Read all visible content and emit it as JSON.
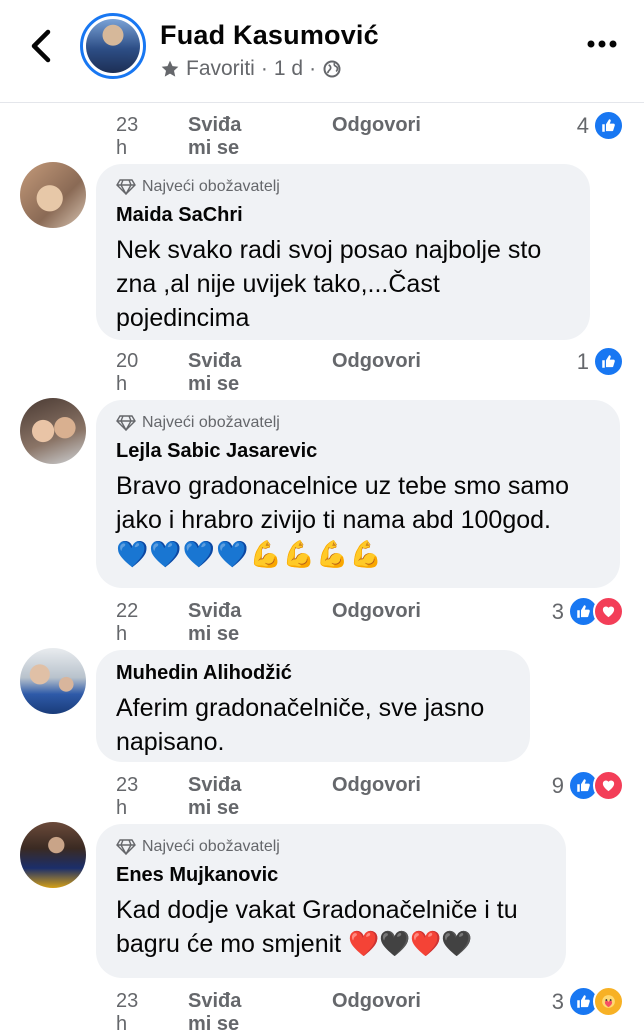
{
  "header": {
    "name": "Fuad Kasumović",
    "favorites": "Favoriti",
    "sep1": "·",
    "time": "1 d",
    "sep2": "·"
  },
  "top_actions": {
    "time": "23 h",
    "like": "Sviđa mi se",
    "reply": "Odgovori",
    "count": "4"
  },
  "comments": [
    {
      "badge": "Najveći obožavatelj",
      "author": "Maida SaChri",
      "text": [
        "Nek svako radi svoj posao najbolje sto",
        "zna ,al nije uvijek tako,...Čast",
        "pojedincima"
      ],
      "time": "20 h",
      "like": "Sviđa mi se",
      "reply": "Odgovori",
      "count": "1"
    },
    {
      "badge": "Najveći obožavatelj",
      "author": "Lejla Sabic Jasarevic",
      "text": [
        "Bravo gradonacelnice uz tebe smo samo",
        "jako i hrabro zivijo ti nama abd 100god.",
        "💙💙💙💙💪💪💪💪"
      ],
      "time": "22 h",
      "like": "Sviđa mi se",
      "reply": "Odgovori",
      "count": "3"
    },
    {
      "author": "Muhedin Alihodžić",
      "text": [
        "Aferim gradonačelniče, sve jasno",
        "napisano."
      ],
      "time": "23 h",
      "like": "Sviđa mi se",
      "reply": "Odgovori",
      "count": "9"
    },
    {
      "badge": "Najveći obožavatelj",
      "author": "Enes Mujkanovic",
      "text": [
        "Kad dodje vakat Gradonačelniče i tu",
        "bagru će mo smjenit ❤️🖤❤️🖤"
      ],
      "time": "23 h",
      "like": "Sviđa mi se",
      "reply": "Odgovori",
      "count": "3"
    }
  ],
  "colors": {
    "accent": "#1877f2",
    "bubble": "#f0f2f5",
    "muted": "#65676b",
    "love": "#f33e58"
  }
}
